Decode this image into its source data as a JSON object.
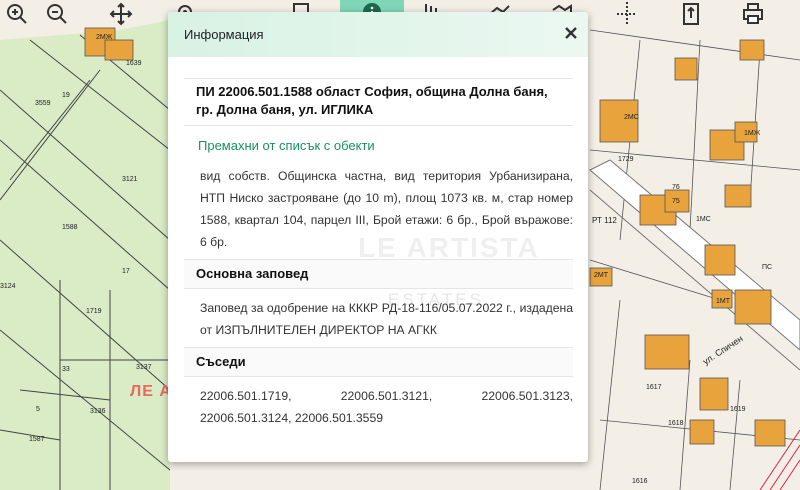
{
  "panel": {
    "title": "Информация",
    "parcel_heading": "ПИ 22006.501.1588 област София, община Долна баня, гр. Долна баня, ул. ИГЛИКА",
    "remove_link": "Премахни от списък с обекти",
    "details": "вид собств. Общинска частна, вид територия Урбанизирана, НТП Ниско застрояване (до 10 m), площ 1073 кв. м, стар номер 1588, квартал 104, парцел III, Брой етажи: 6 бр., Брой въражове: 6 бр.",
    "order_heading": "Основна заповед",
    "order_text": "Заповед за одобрение на КККР РД-18-116/05.07.2022 г., издадена от ИЗПЪЛНИТЕЛЕН ДИРЕКТОР НА АГКК",
    "neighbors_heading": "Съседи",
    "neighbors": [
      "22006.501.1719,",
      "22006.501.3121,",
      "22006.501.3123,",
      "22006.501.3124,",
      "22006.501.3559"
    ]
  },
  "map": {
    "parcel_labels": [
      "3559",
      "3121",
      "1588",
      "3124",
      "1719",
      "3137",
      "3136",
      "1587",
      "33",
      "19",
      "17",
      "5",
      "1639",
      "1729",
      "76",
      "75",
      "1617",
      "1618",
      "1619",
      "1616",
      "2МЖ",
      "1МЖ",
      "2МС",
      "1МС",
      "ПС",
      "1МТ",
      "2МТ"
    ],
    "road_label": "ул. Спичен",
    "rt_label": "РТ 112",
    "watermark": "ЛЕ АРТИСТА",
    "panel_watermark": "LE ARTISTA",
    "panel_watermark_sub": "THE ART OF ESTATES"
  },
  "toolbar": {
    "tools": [
      "zoom-in",
      "zoom-out",
      "pan",
      "locate",
      "select",
      "info",
      "chart",
      "measure",
      "layers",
      "crosshair",
      "export",
      "print"
    ]
  },
  "colors": {
    "accent": "#199060",
    "active_tool": "#7fd7b8",
    "building": "#e8a33d",
    "green_area": "#d8ecc4"
  }
}
